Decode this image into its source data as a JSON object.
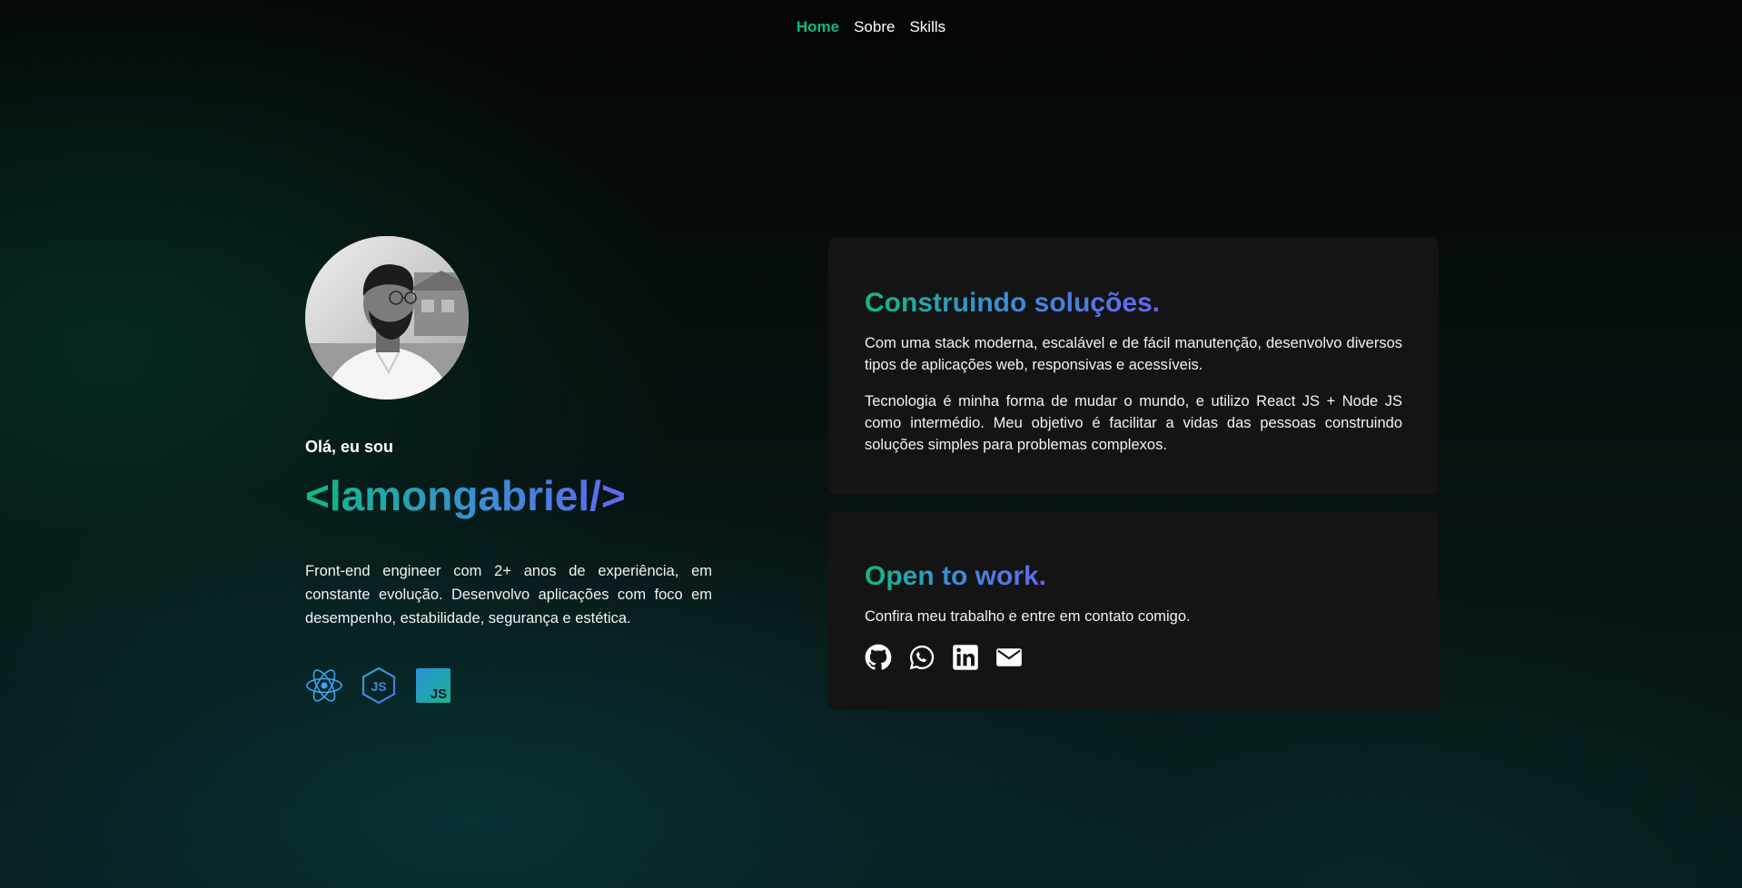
{
  "nav": {
    "items": [
      {
        "label": "Home",
        "active": true
      },
      {
        "label": "Sobre",
        "active": false
      },
      {
        "label": "Skills",
        "active": false
      }
    ]
  },
  "hero": {
    "avatar_alt": "Foto de perfil",
    "intro": "Olá, eu sou",
    "handle": "<lamongabriel/>",
    "bio": "Front-end engineer com 2+ anos de experiência, em constante evolução. Desenvolvo aplicações com foco em desempenho, estabilidade, segurança e estética.",
    "tech_icons": [
      "react-icon",
      "nodejs-icon",
      "javascript-icon"
    ]
  },
  "card_solutions": {
    "title": "Construindo soluções.",
    "paragraph_1": "Com uma stack moderna, escalável e de fácil manutenção, desenvolvo diversos tipos de aplicações web, responsivas e acessíveis.",
    "paragraph_2": "Tecnologia é minha forma de mudar o mundo, e utilizo React JS + Node JS como intermédio. Meu objetivo é facilitar a vidas das pessoas construindo soluções simples para problemas complexos."
  },
  "card_work": {
    "title": "Open to work.",
    "text": "Confira meu trabalho e entre em contato comigo.",
    "social_icons": [
      "github-icon",
      "whatsapp-icon",
      "linkedin-icon",
      "email-icon"
    ]
  },
  "colors": {
    "accent_green": "#10b981",
    "accent_indigo": "#6366f1",
    "card_bg": "#141414"
  }
}
